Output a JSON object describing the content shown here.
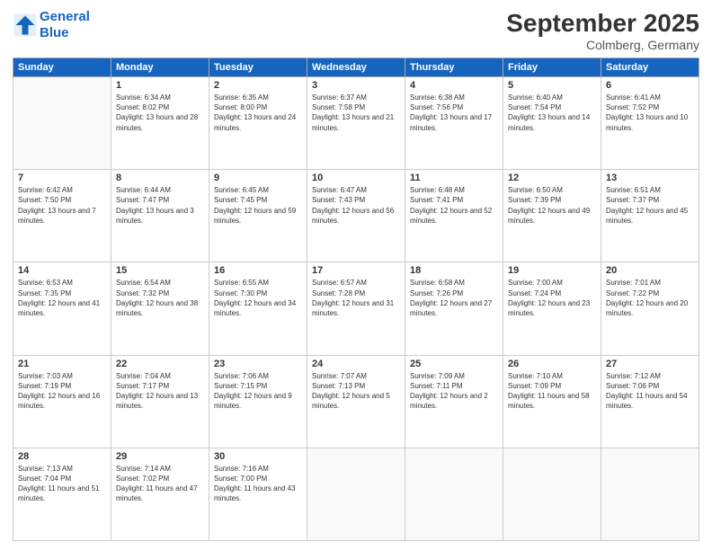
{
  "logo": {
    "line1": "General",
    "line2": "Blue"
  },
  "title": "September 2025",
  "location": "Colmberg, Germany",
  "days_header": [
    "Sunday",
    "Monday",
    "Tuesday",
    "Wednesday",
    "Thursday",
    "Friday",
    "Saturday"
  ],
  "weeks": [
    [
      {
        "day": "",
        "sunrise": "",
        "sunset": "",
        "daylight": ""
      },
      {
        "day": "1",
        "sunrise": "Sunrise: 6:34 AM",
        "sunset": "Sunset: 8:02 PM",
        "daylight": "Daylight: 13 hours and 28 minutes."
      },
      {
        "day": "2",
        "sunrise": "Sunrise: 6:35 AM",
        "sunset": "Sunset: 8:00 PM",
        "daylight": "Daylight: 13 hours and 24 minutes."
      },
      {
        "day": "3",
        "sunrise": "Sunrise: 6:37 AM",
        "sunset": "Sunset: 7:58 PM",
        "daylight": "Daylight: 13 hours and 21 minutes."
      },
      {
        "day": "4",
        "sunrise": "Sunrise: 6:38 AM",
        "sunset": "Sunset: 7:56 PM",
        "daylight": "Daylight: 13 hours and 17 minutes."
      },
      {
        "day": "5",
        "sunrise": "Sunrise: 6:40 AM",
        "sunset": "Sunset: 7:54 PM",
        "daylight": "Daylight: 13 hours and 14 minutes."
      },
      {
        "day": "6",
        "sunrise": "Sunrise: 6:41 AM",
        "sunset": "Sunset: 7:52 PM",
        "daylight": "Daylight: 13 hours and 10 minutes."
      }
    ],
    [
      {
        "day": "7",
        "sunrise": "Sunrise: 6:42 AM",
        "sunset": "Sunset: 7:50 PM",
        "daylight": "Daylight: 13 hours and 7 minutes."
      },
      {
        "day": "8",
        "sunrise": "Sunrise: 6:44 AM",
        "sunset": "Sunset: 7:47 PM",
        "daylight": "Daylight: 13 hours and 3 minutes."
      },
      {
        "day": "9",
        "sunrise": "Sunrise: 6:45 AM",
        "sunset": "Sunset: 7:45 PM",
        "daylight": "Daylight: 12 hours and 59 minutes."
      },
      {
        "day": "10",
        "sunrise": "Sunrise: 6:47 AM",
        "sunset": "Sunset: 7:43 PM",
        "daylight": "Daylight: 12 hours and 56 minutes."
      },
      {
        "day": "11",
        "sunrise": "Sunrise: 6:48 AM",
        "sunset": "Sunset: 7:41 PM",
        "daylight": "Daylight: 12 hours and 52 minutes."
      },
      {
        "day": "12",
        "sunrise": "Sunrise: 6:50 AM",
        "sunset": "Sunset: 7:39 PM",
        "daylight": "Daylight: 12 hours and 49 minutes."
      },
      {
        "day": "13",
        "sunrise": "Sunrise: 6:51 AM",
        "sunset": "Sunset: 7:37 PM",
        "daylight": "Daylight: 12 hours and 45 minutes."
      }
    ],
    [
      {
        "day": "14",
        "sunrise": "Sunrise: 6:53 AM",
        "sunset": "Sunset: 7:35 PM",
        "daylight": "Daylight: 12 hours and 41 minutes."
      },
      {
        "day": "15",
        "sunrise": "Sunrise: 6:54 AM",
        "sunset": "Sunset: 7:32 PM",
        "daylight": "Daylight: 12 hours and 38 minutes."
      },
      {
        "day": "16",
        "sunrise": "Sunrise: 6:55 AM",
        "sunset": "Sunset: 7:30 PM",
        "daylight": "Daylight: 12 hours and 34 minutes."
      },
      {
        "day": "17",
        "sunrise": "Sunrise: 6:57 AM",
        "sunset": "Sunset: 7:28 PM",
        "daylight": "Daylight: 12 hours and 31 minutes."
      },
      {
        "day": "18",
        "sunrise": "Sunrise: 6:58 AM",
        "sunset": "Sunset: 7:26 PM",
        "daylight": "Daylight: 12 hours and 27 minutes."
      },
      {
        "day": "19",
        "sunrise": "Sunrise: 7:00 AM",
        "sunset": "Sunset: 7:24 PM",
        "daylight": "Daylight: 12 hours and 23 minutes."
      },
      {
        "day": "20",
        "sunrise": "Sunrise: 7:01 AM",
        "sunset": "Sunset: 7:22 PM",
        "daylight": "Daylight: 12 hours and 20 minutes."
      }
    ],
    [
      {
        "day": "21",
        "sunrise": "Sunrise: 7:03 AM",
        "sunset": "Sunset: 7:19 PM",
        "daylight": "Daylight: 12 hours and 16 minutes."
      },
      {
        "day": "22",
        "sunrise": "Sunrise: 7:04 AM",
        "sunset": "Sunset: 7:17 PM",
        "daylight": "Daylight: 12 hours and 13 minutes."
      },
      {
        "day": "23",
        "sunrise": "Sunrise: 7:06 AM",
        "sunset": "Sunset: 7:15 PM",
        "daylight": "Daylight: 12 hours and 9 minutes."
      },
      {
        "day": "24",
        "sunrise": "Sunrise: 7:07 AM",
        "sunset": "Sunset: 7:13 PM",
        "daylight": "Daylight: 12 hours and 5 minutes."
      },
      {
        "day": "25",
        "sunrise": "Sunrise: 7:09 AM",
        "sunset": "Sunset: 7:11 PM",
        "daylight": "Daylight: 12 hours and 2 minutes."
      },
      {
        "day": "26",
        "sunrise": "Sunrise: 7:10 AM",
        "sunset": "Sunset: 7:09 PM",
        "daylight": "Daylight: 11 hours and 58 minutes."
      },
      {
        "day": "27",
        "sunrise": "Sunrise: 7:12 AM",
        "sunset": "Sunset: 7:06 PM",
        "daylight": "Daylight: 11 hours and 54 minutes."
      }
    ],
    [
      {
        "day": "28",
        "sunrise": "Sunrise: 7:13 AM",
        "sunset": "Sunset: 7:04 PM",
        "daylight": "Daylight: 11 hours and 51 minutes."
      },
      {
        "day": "29",
        "sunrise": "Sunrise: 7:14 AM",
        "sunset": "Sunset: 7:02 PM",
        "daylight": "Daylight: 11 hours and 47 minutes."
      },
      {
        "day": "30",
        "sunrise": "Sunrise: 7:16 AM",
        "sunset": "Sunset: 7:00 PM",
        "daylight": "Daylight: 11 hours and 43 minutes."
      },
      {
        "day": "",
        "sunrise": "",
        "sunset": "",
        "daylight": ""
      },
      {
        "day": "",
        "sunrise": "",
        "sunset": "",
        "daylight": ""
      },
      {
        "day": "",
        "sunrise": "",
        "sunset": "",
        "daylight": ""
      },
      {
        "day": "",
        "sunrise": "",
        "sunset": "",
        "daylight": ""
      }
    ]
  ]
}
